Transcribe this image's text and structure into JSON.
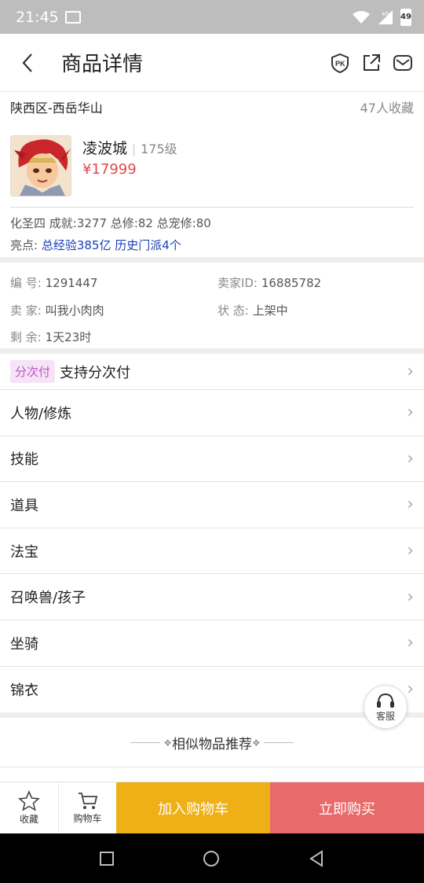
{
  "status": {
    "time": "21:45",
    "network": "4G",
    "battery": "49"
  },
  "header": {
    "title": "商品详情"
  },
  "region": {
    "name": "陕西区-西岳华山",
    "favorites": "47人收藏"
  },
  "product": {
    "name": "凌波城",
    "separator": "|",
    "level": "175级",
    "price": "¥17999",
    "stats": "化圣四 成就:3277 总修:82 总宠修:80",
    "highlight_label": "亮点:",
    "highlight_value": "总经验385亿 历史门派4个"
  },
  "info": {
    "id_label": "编 号:",
    "id_value": "1291447",
    "seller_id_label": "卖家ID:",
    "seller_id_value": "16885782",
    "seller_label": "卖 家:",
    "seller_value": "叫我小肉肉",
    "status_label": "状 态:",
    "status_value": "上架中",
    "remaining_label": "剩 余:",
    "remaining_value": "1天23时"
  },
  "menu": [
    {
      "badge": "分次付",
      "label": "支持分次付"
    },
    {
      "label": "人物/修炼"
    },
    {
      "label": "技能"
    },
    {
      "label": "道具"
    },
    {
      "label": "法宝"
    },
    {
      "label": "召唤兽/孩子"
    },
    {
      "label": "坐骑"
    },
    {
      "label": "锦衣"
    }
  ],
  "kefu": {
    "label": "客服"
  },
  "similar": {
    "title": "相似物品推荐"
  },
  "bottom": {
    "favorite": "收藏",
    "cart": "购物车",
    "add_to_cart": "加入购物车",
    "buy_now": "立即购买"
  },
  "colors": {
    "price": "#e04a4a",
    "highlight": "#1a3fb8",
    "add_to_cart": "#eeb016",
    "buy_now": "#e86a6a",
    "badge": "#c054c5"
  }
}
